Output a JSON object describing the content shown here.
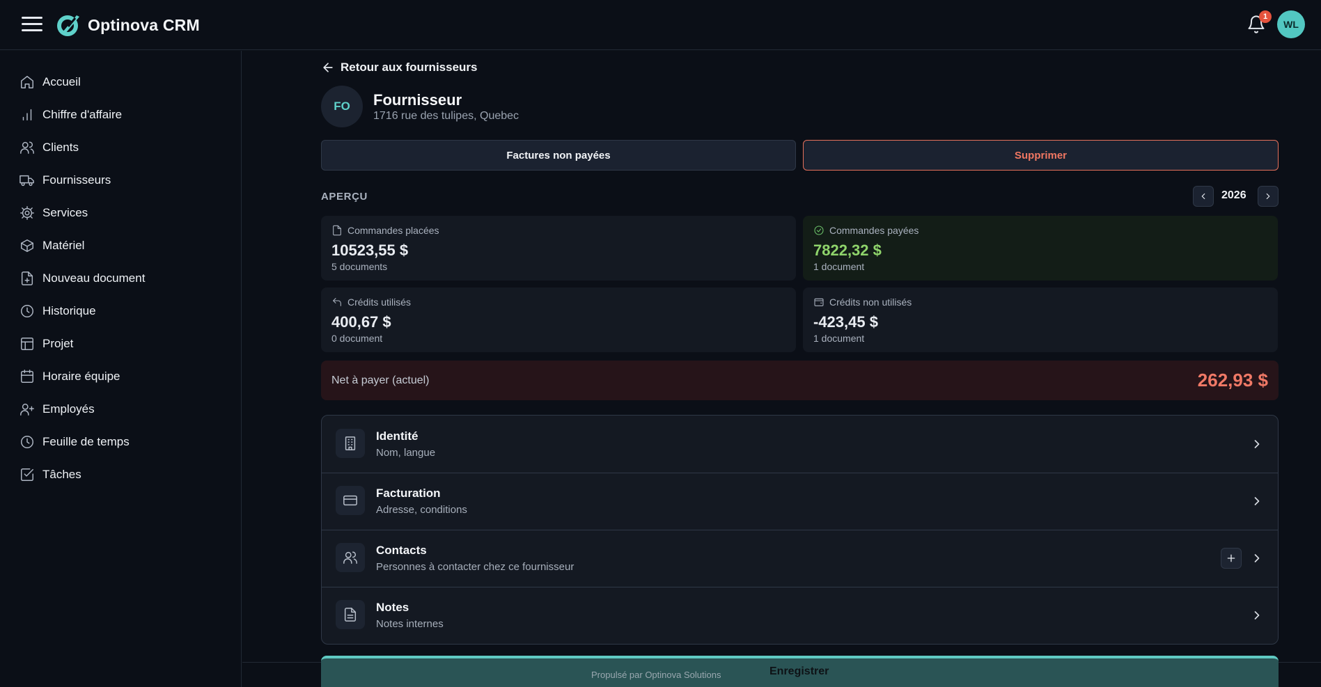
{
  "app": {
    "title": "Optinova CRM",
    "notification_count": "1",
    "user_initials": "WL"
  },
  "sidebar": {
    "items": [
      {
        "label": "Accueil",
        "icon": "home-icon"
      },
      {
        "label": "Chiffre d'affaire",
        "icon": "bar-chart-icon"
      },
      {
        "label": "Clients",
        "icon": "users-icon"
      },
      {
        "label": "Fournisseurs",
        "icon": "truck-icon"
      },
      {
        "label": "Services",
        "icon": "gear-icon"
      },
      {
        "label": "Matériel",
        "icon": "box-icon"
      },
      {
        "label": "Nouveau document",
        "icon": "file-plus-icon"
      },
      {
        "label": "Historique",
        "icon": "clock-icon"
      },
      {
        "label": "Projet",
        "icon": "layout-icon"
      },
      {
        "label": "Horaire équipe",
        "icon": "calendar-icon"
      },
      {
        "label": "Employés",
        "icon": "user-plus-icon"
      },
      {
        "label": "Feuille de temps",
        "icon": "clock-icon"
      },
      {
        "label": "Tâches",
        "icon": "checkbox-icon"
      }
    ]
  },
  "main": {
    "back_label": "Retour aux fournisseurs",
    "supplier": {
      "initials": "FO",
      "name": "Fournisseur",
      "address": "1716 rue des tulipes, Quebec"
    },
    "buttons": {
      "unpaid": "Factures non payées",
      "delete": "Supprimer"
    },
    "overview": {
      "title": "APERÇU",
      "year": "2026",
      "stats": [
        {
          "label": "Commandes placées",
          "value": "10523,55 $",
          "sub": "5 documents",
          "icon": "file-icon"
        },
        {
          "label": "Commandes payées",
          "value": "7822,32 $",
          "sub": "1 document",
          "icon": "check-circle-icon"
        },
        {
          "label": "Crédits utilisés",
          "value": "400,67 $",
          "sub": "0 document",
          "icon": "undo-icon"
        },
        {
          "label": "Crédits non utilisés",
          "value": "-423,45 $",
          "sub": "1 document",
          "icon": "wallet-icon"
        }
      ],
      "net": {
        "label": "Net à payer (actuel)",
        "value": "262,93 $"
      }
    },
    "sections": [
      {
        "title": "Identité",
        "subtitle": "Nom, langue",
        "icon": "building-icon"
      },
      {
        "title": "Facturation",
        "subtitle": "Adresse, conditions",
        "icon": "credit-card-icon"
      },
      {
        "title": "Contacts",
        "subtitle": "Personnes à contacter chez ce fournisseur",
        "icon": "users-icon"
      },
      {
        "title": "Notes",
        "subtitle": "Notes internes",
        "icon": "document-icon"
      }
    ]
  },
  "footer": {
    "save_label": "Enregistrer",
    "powered_by": "Propulsé par Optinova Solutions"
  },
  "colors": {
    "accent": "#52c7c1",
    "danger": "#f07762",
    "success": "#8fd46b",
    "background": "#0b0f17"
  }
}
